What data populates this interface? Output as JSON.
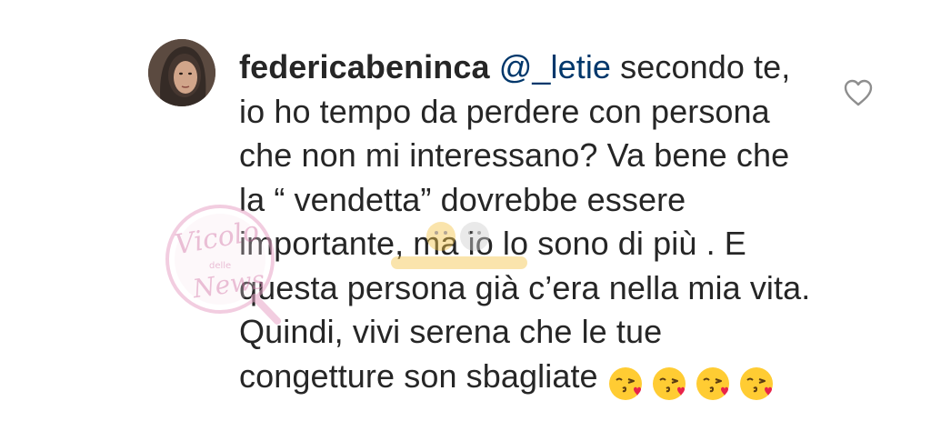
{
  "comment": {
    "username": "federicabeninca",
    "mention": "@_letie",
    "text_after_mention": " secondo te, io ho tempo da perdere con persona che non mi interessano? Va bene che la “ vendetta” dovrebbe essere importante, ma io lo sono di più . E questa persona già c’era nella mia vita. Quindi, vivi serena che le tue congetture son sbagliate ",
    "emoji": [
      "kissing-face-with-heart-icon",
      "kissing-face-with-heart-icon",
      "kissing-face-with-heart-icon",
      "kissing-face-with-heart-icon"
    ]
  },
  "watermark": {
    "text": "Vicolo delle News"
  },
  "colors": {
    "text": "#262626",
    "mention": "#00376b",
    "heart_outline": "#8e8e8e",
    "watermark": "#e8a6c8"
  }
}
